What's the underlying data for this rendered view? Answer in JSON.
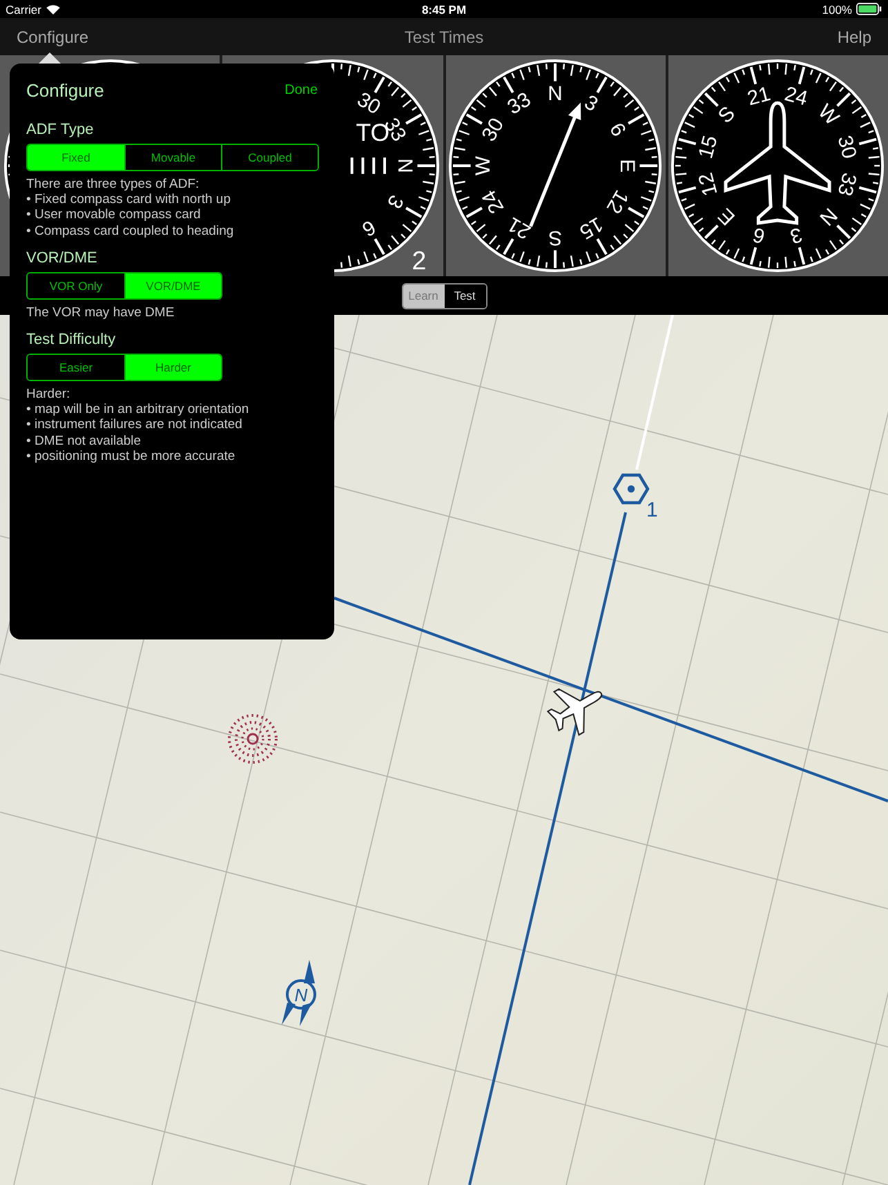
{
  "status_bar": {
    "carrier": "Carrier",
    "time": "8:45 PM",
    "battery": "100%"
  },
  "nav_bar": {
    "left": "Configure",
    "title": "Test Times",
    "right": "Help"
  },
  "instruments": [
    {
      "kind": "plain"
    },
    {
      "kind": "cdi",
      "labels": [
        "30",
        "33",
        "N",
        "3",
        "6"
      ],
      "flag": "TO",
      "number": "2"
    },
    {
      "kind": "adf",
      "labels": [
        "N",
        "3",
        "6",
        "E",
        "12",
        "15",
        "S",
        "21",
        "24",
        "W",
        "30",
        "33"
      ]
    },
    {
      "kind": "heading",
      "labels": [
        "N",
        "3",
        "6",
        "E",
        "12",
        "15",
        "S",
        "21",
        "24",
        "W",
        "30",
        "33"
      ]
    }
  ],
  "mode_switch": [
    {
      "label": "Learn",
      "selected": true
    },
    {
      "label": "Test",
      "selected": false
    }
  ],
  "popover": {
    "title": "Configure",
    "done": "Done",
    "sections": [
      {
        "title": "ADF Type",
        "options": [
          {
            "label": "Fixed",
            "selected": true
          },
          {
            "label": "Movable",
            "selected": false
          },
          {
            "label": "Coupled",
            "selected": false
          }
        ],
        "description": [
          "There are three types of ADF:",
          "• Fixed compass card with north up",
          "• User movable compass card",
          "• Compass card coupled to heading"
        ]
      },
      {
        "title": "VOR/DME",
        "options": [
          {
            "label": "VOR Only",
            "selected": false
          },
          {
            "label": "VOR/DME",
            "selected": true
          }
        ],
        "description": [
          "The VOR may have DME"
        ]
      },
      {
        "title": "Test Difficulty",
        "options": [
          {
            "label": "Easier",
            "selected": false
          },
          {
            "label": "Harder",
            "selected": true
          }
        ],
        "description": [
          "Harder:",
          "• map will be in an arbitrary orientation",
          "• instrument failures are not indicated",
          "• DME not available",
          "• positioning must be more accurate"
        ]
      }
    ]
  },
  "map": {
    "station_number": "1",
    "north_label": "N"
  }
}
